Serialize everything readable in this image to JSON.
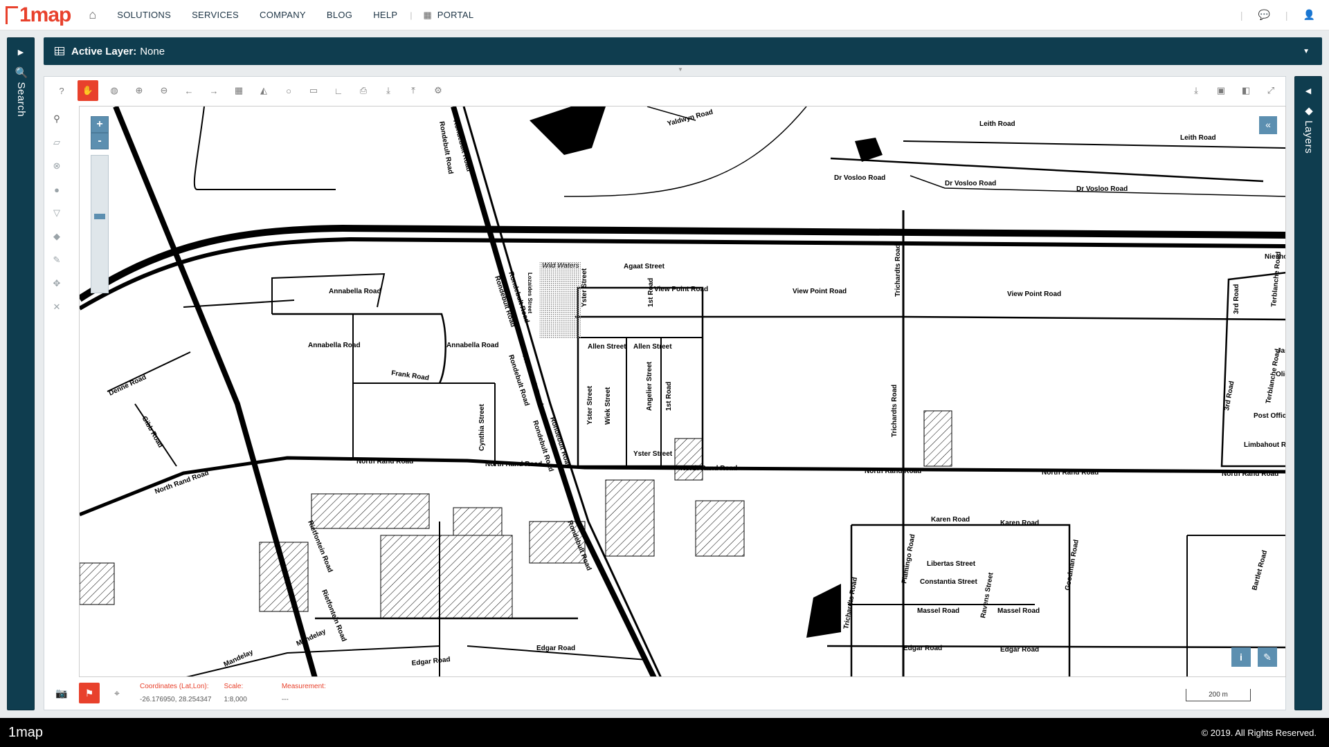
{
  "nav": {
    "logo": "1map",
    "items": [
      "SOLUTIONS",
      "SERVICES",
      "COMPANY",
      "BLOG",
      "HELP"
    ],
    "portal": "PORTAL"
  },
  "search_panel": {
    "label": "Search"
  },
  "layers_panel": {
    "label": "Layers"
  },
  "active_layer": {
    "label": "Active Layer:",
    "value": "None"
  },
  "map": {
    "labels": [
      "Rondebult Road",
      "Rondebult Road",
      "Rondebult Road",
      "Rondebult Road",
      "Rondebult Road",
      "Rondebult Road",
      "Rondebult Road",
      "Rondebult Road",
      "Rondebult Road",
      "Yaldwyn Road",
      "Leith Road",
      "Leith Road",
      "Dr Vosloo Road",
      "Dr Vosloo Road",
      "Dr Vosloo Road",
      "Wild Waters",
      "Agaat Street",
      "Yster Street",
      "1st Road",
      "View Point Road",
      "View Point Road",
      "View Point Road",
      "Trichardts Road",
      "Trichardts Road",
      "Trichardts Road",
      "Niesho",
      "3rd Road",
      "3rd Road",
      "Terblanche Road",
      "Terblanche Road",
      "Post Office",
      "Limbahout Ro",
      "Annabella Road",
      "Annabella Road",
      "Annabella Road",
      "Frank Road",
      "Denne Road",
      "Gibb Road",
      "Cynthia Street",
      "Allen Street",
      "Allen Street",
      "Yster Street",
      "Wiek Street",
      "Angelier Street",
      "1st Road",
      "Yster Street",
      "Lozaides Street",
      "North Rand Road",
      "North Rand Road",
      "North Rand Road",
      "North Rand Road",
      "North Rand Road",
      "North Rand Road",
      "North Rand Road",
      "Rietfontein Road",
      "Rietfontein Road",
      "Mandelay",
      "Mandelay",
      "Karen Road",
      "Karen Road",
      "Libertas Street",
      "Constantia Street",
      "Massel Road",
      "Massel Road",
      "Ravens Street",
      "Flamingo Road",
      "Goodman Road",
      "Bartlet Road",
      "Edgar Road",
      "Edgar Road",
      "Edgar Road",
      "Edgar Road",
      "Olien",
      "Jas"
    ]
  },
  "zoom": {
    "in": "+",
    "out": "-"
  },
  "status": {
    "coord_label": "Coordinates (Lat,Lon):",
    "coord_value": "-26.176950, 28.254347",
    "scale_label": "Scale:",
    "scale_value": "1:8,000",
    "measure_label": "Measurement:",
    "measure_value": "---",
    "scalebar": "200 m"
  },
  "footer": {
    "logo": "1map",
    "copyright": "© 2019. All Rights Reserved."
  },
  "colors": {
    "accent": "#e8412c",
    "panel": "#0f3d4f",
    "button": "#5c8fb0"
  }
}
